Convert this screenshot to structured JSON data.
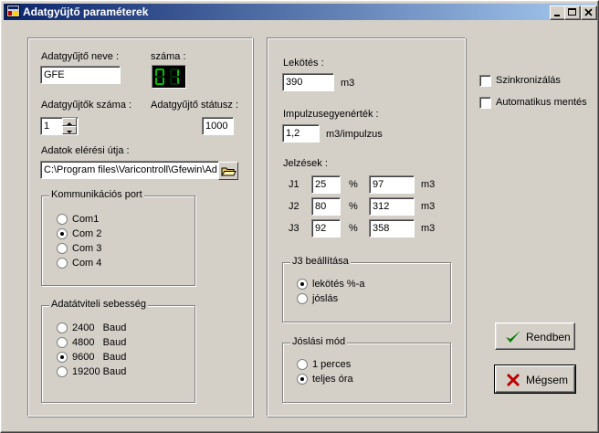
{
  "window": {
    "title": "Adatgyűjtő paraméterek"
  },
  "left": {
    "name_label": "Adatgyűjtő neve :",
    "name_value": "GFE",
    "number_label": "száma :",
    "number_value": "01",
    "count_label": "Adatgyűjtők száma :",
    "count_value": "1",
    "status_label": "Adatgyűjtő státusz :",
    "status_value": "1000",
    "path_label": "Adatok elérési útja :",
    "path_value": "C:\\Program files\\Varicontroll\\Gfewin\\Ad",
    "port_group": {
      "title": "Kommunikációs port",
      "options": [
        "Com1",
        "Com 2",
        "Com 3",
        "Com 4"
      ],
      "selected": "Com 2"
    },
    "baud_group": {
      "title": "Adatátviteli sebesség",
      "options": [
        "2400   Baud",
        "4800   Baud",
        "9600   Baud",
        "19200 Baud"
      ],
      "selected": "9600   Baud"
    }
  },
  "middle": {
    "lekotes_label": "Lekötés :",
    "lekotes_value": "390",
    "lekotes_unit": "m3",
    "impulse_label": "Impulzusegyenérték :",
    "impulse_value": "1,2",
    "impulse_unit": "m3/impulzus",
    "signals_label": "Jelzések :",
    "signals": [
      {
        "name": "J1",
        "percent": "25",
        "pct_symbol": "%",
        "amount": "97",
        "unit": "m3"
      },
      {
        "name": "J2",
        "percent": "80",
        "pct_symbol": "%",
        "amount": "312",
        "unit": "m3"
      },
      {
        "name": "J3",
        "percent": "92",
        "pct_symbol": "%",
        "amount": "358",
        "unit": "m3"
      }
    ],
    "j3_group": {
      "title": "J3 beállítása",
      "options": [
        "lekötés %-a",
        "jóslás"
      ],
      "selected": "lekötés %-a"
    },
    "forecast_group": {
      "title": "Jóslási mód",
      "options": [
        "1 perces",
        "teljes óra"
      ],
      "selected": "teljes óra"
    }
  },
  "right": {
    "sync_label": "Szinkronizálás",
    "sync_checked": false,
    "autosave_label": "Automatikus mentés",
    "autosave_checked": false,
    "ok_label": "Rendben",
    "cancel_label": "Mégsem"
  }
}
